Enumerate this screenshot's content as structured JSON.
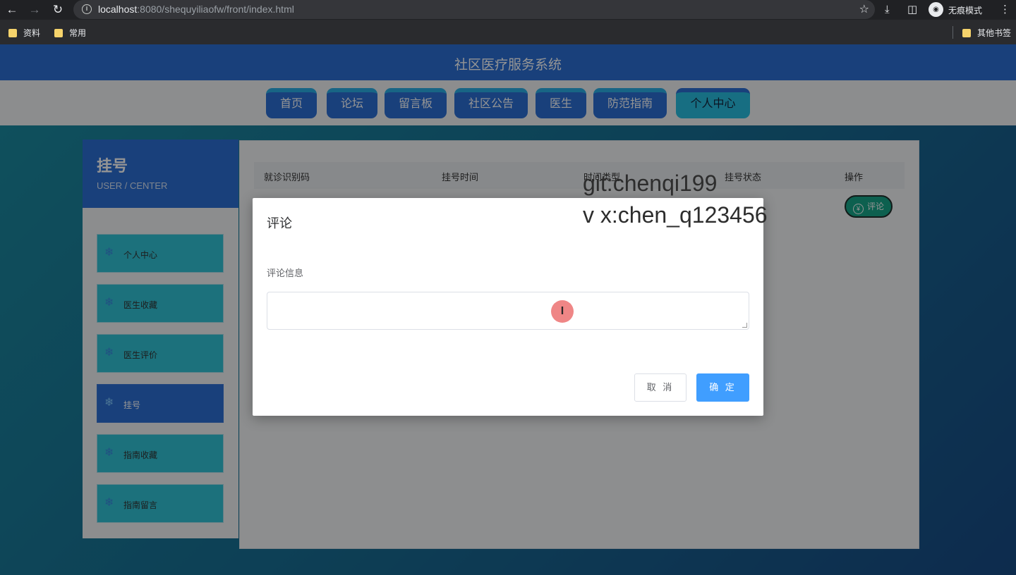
{
  "browser": {
    "url_host": "localhost",
    "url_rest": ":8080/shequyiliaofw/front/index.html",
    "incognito_label": "无痕模式",
    "bookmarks": [
      "资料",
      "常用"
    ],
    "other_bookmarks": "其他书签"
  },
  "site": {
    "title": "社区医疗服务系统",
    "nav": [
      "首页",
      "论坛",
      "留言板",
      "社区公告",
      "医生",
      "防范指南",
      "个人中心"
    ],
    "active_nav": "个人中心"
  },
  "sidebar": {
    "title": "挂号",
    "subtitle": "USER / CENTER",
    "items": [
      "个人中心",
      "医生收藏",
      "医生评价",
      "挂号",
      "指南收藏",
      "指南留言"
    ],
    "active_item": "挂号"
  },
  "table": {
    "headers": [
      "就诊识别码",
      "挂号时间",
      "时间类型",
      "挂号状态",
      "操作"
    ],
    "row_action": "评论"
  },
  "modal": {
    "title": "评论",
    "field_label": "评论信息",
    "field_value": "",
    "cancel": "取 消",
    "confirm": "确 定"
  },
  "watermark": {
    "line1": "git:chenqi199",
    "line2": "v x:chen_q123456"
  }
}
